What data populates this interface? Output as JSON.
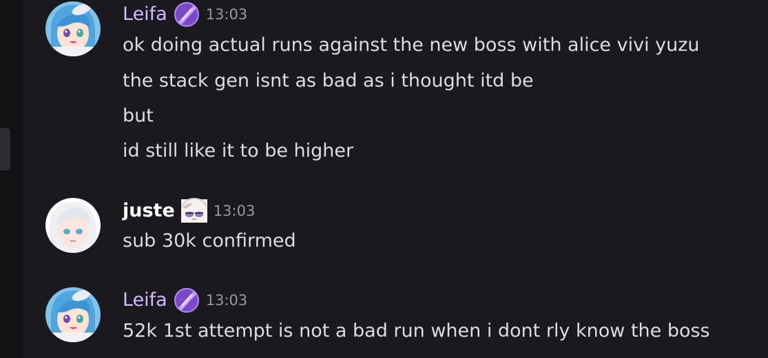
{
  "messages": [
    {
      "author": "Leifa",
      "badge": "purple-gem-icon",
      "time": "13:03",
      "lines": [
        "ok doing actual runs against the new boss  with alice vivi yuzu",
        "the stack gen isnt as bad as i thought itd be",
        "but",
        "id still like it to be higher"
      ]
    },
    {
      "author": "juste",
      "badge": "anime-face-emoji-icon",
      "time": "13:03",
      "lines": [
        "sub 30k confirmed"
      ]
    },
    {
      "author": "Leifa",
      "badge": "purple-gem-icon",
      "time": "13:03",
      "lines": [
        "52k 1st attempt is not a bad run when i dont rly know the boss"
      ]
    }
  ],
  "colors": {
    "background": "#1a1a1e",
    "leifa_name": "#d6b9ff",
    "juste_name": "#ffffff",
    "timestamp": "#949ba4",
    "message_text": "#dbdee1"
  }
}
